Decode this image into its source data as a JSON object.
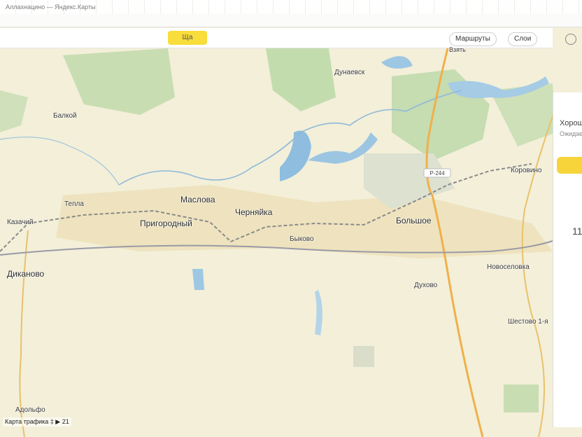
{
  "browser": {
    "tab_strip_text": "Аллахнацино — Яндекс.Карты"
  },
  "toolbar": {
    "badge_label": "Ща",
    "routes_label": "Маршруты",
    "routes_sublabel": "Взять",
    "layers_label": "Слои"
  },
  "map": {
    "places": [
      {
        "key": "duvansk",
        "name": "Дунаевск"
      },
      {
        "key": "balki",
        "name": "Балкой"
      },
      {
        "key": "tepla",
        "name": "Тепла"
      },
      {
        "key": "maslovo",
        "name": "Маслова"
      },
      {
        "key": "chernyavka",
        "name": "Черняйка"
      },
      {
        "key": "prigorodny",
        "name": "Пригородный"
      },
      {
        "key": "bolshoe",
        "name": "Большое"
      },
      {
        "key": "bykovo",
        "name": "Быково"
      },
      {
        "key": "dikanovo",
        "name": "Диканово"
      },
      {
        "key": "novoselovka",
        "name": "Новоселовка"
      },
      {
        "key": "dukhovo",
        "name": "Духово"
      },
      {
        "key": "shestovo",
        "name": "Шестово 1-я"
      },
      {
        "key": "adolfo",
        "name": "Адольфо"
      },
      {
        "key": "korovino",
        "name": "Коровино"
      },
      {
        "key": "kazachy",
        "name": "Казачий"
      }
    ],
    "road_badge": "Р-244"
  },
  "right_panel": {
    "title": "Хорош",
    "subtitle": "Ожидает",
    "number": "11"
  },
  "footer": {
    "text": "Карта трафика ‡ ▶ 21"
  },
  "colors": {
    "water": "#9ec7e3",
    "forest": "#c3dcae",
    "road": "#f0b04a",
    "urban": "#e9dfb9",
    "land": "#f3efd9"
  }
}
